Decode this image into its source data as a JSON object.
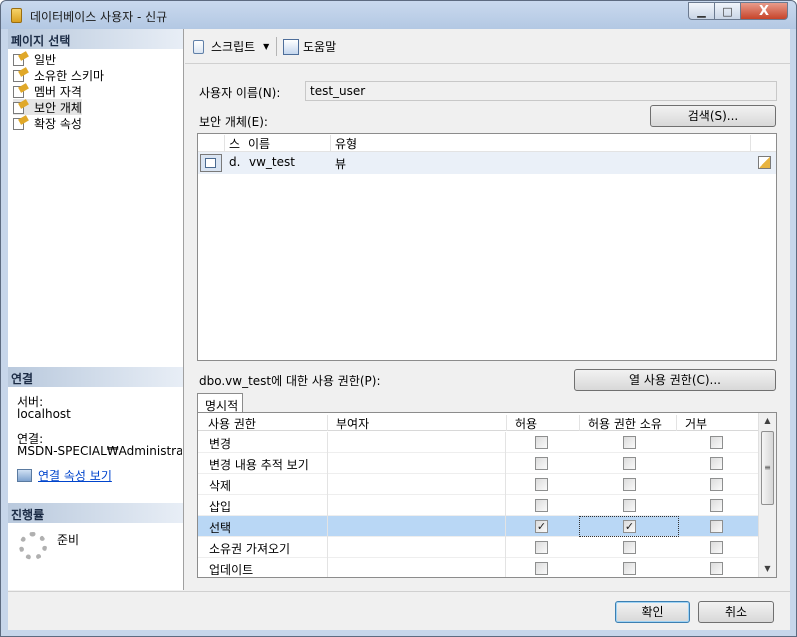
{
  "window": {
    "title": "데이터베이스 사용자 - 신규",
    "min_label": "▁",
    "max_label": "□",
    "close_label": "X"
  },
  "left": {
    "page_select_title": "페이지 선택",
    "pages": [
      "일반",
      "소유한 스키마",
      "멤버 자격",
      "보안 개체",
      "확장 속성"
    ],
    "connection_title": "연결",
    "server_label": "서버:",
    "server_value": "localhost",
    "conn_label": "연결:",
    "conn_value": "MSDN-SPECIAL₩Administra",
    "view_conn_props": "연결 속성 보기",
    "progress_title": "진행률",
    "progress_status": "준비"
  },
  "toolbar": {
    "script_label": "스크립트",
    "script_dropdown": "▼",
    "help_label": "도움말"
  },
  "main": {
    "username_label": "사용자 이름(N):",
    "username_value": "test_user",
    "securables_label": "보안 개체(E):",
    "search_button": "검색(S)...",
    "securables_columns": [
      "스",
      "이름",
      "유형"
    ],
    "securables_rows": [
      {
        "schema": "d.",
        "name": "vw_test",
        "type": "뷰"
      }
    ],
    "permissions_label": "dbo.vw_test에 대한 사용 권한(P):",
    "column_permissions_button": "열 사용 권한(C)...",
    "tab_explicit": "명시적",
    "perm_columns": [
      "사용 권한",
      "부여자",
      "허용",
      "허용 권한 소유",
      "거부"
    ],
    "permissions": [
      {
        "name": "변경",
        "grant": false,
        "with_grant": false,
        "deny": false
      },
      {
        "name": "변경 내용 추적 보기",
        "grant": false,
        "with_grant": false,
        "deny": false
      },
      {
        "name": "삭제",
        "grant": false,
        "with_grant": false,
        "deny": false
      },
      {
        "name": "삽입",
        "grant": false,
        "with_grant": false,
        "deny": false
      },
      {
        "name": "선택",
        "grant": true,
        "with_grant": true,
        "deny": false
      },
      {
        "name": "소유권 가져오기",
        "grant": false,
        "with_grant": false,
        "deny": false
      },
      {
        "name": "업데이트",
        "grant": false,
        "with_grant": false,
        "deny": false
      }
    ],
    "selected_permission_index": 4,
    "scroll_up": "▲",
    "scroll_down": "▼",
    "scroll_grip": "≡",
    "check_mark": "✓"
  },
  "footer": {
    "ok_button": "확인",
    "cancel_button": "취소"
  }
}
